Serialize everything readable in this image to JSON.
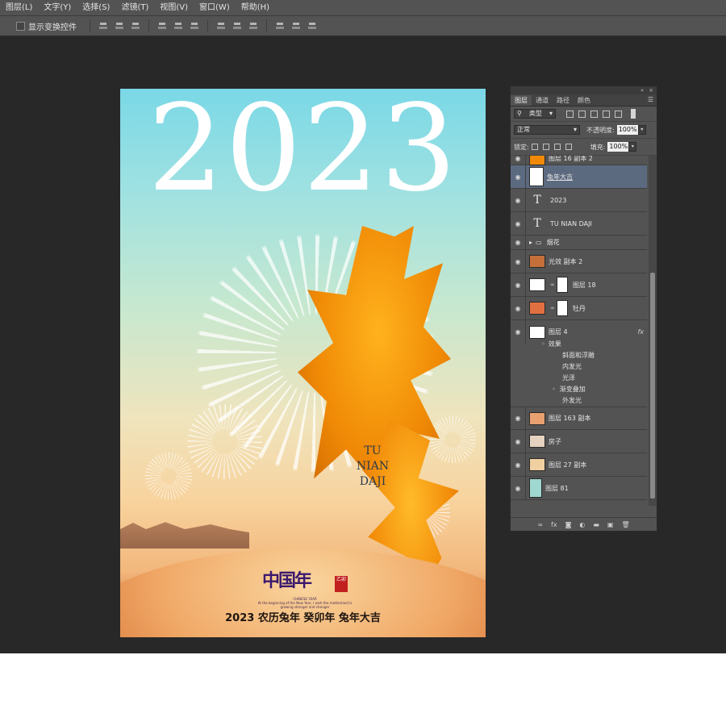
{
  "menu": [
    "图层(L)",
    "文字(Y)",
    "选择(S)",
    "滤镜(T)",
    "视图(V)",
    "窗口(W)",
    "帮助(H)"
  ],
  "options": {
    "show_transform_label": "显示变换控件"
  },
  "poster": {
    "year": "2023",
    "title_latin": [
      "TU",
      "NIAN",
      "DAJI"
    ],
    "brand": "中国年",
    "seal": "乙卯",
    "brand_sub": [
      "CHINESE YEAR",
      "At the beginning of the New Year, I wish the motherland is",
      "growing stronger and stronger"
    ],
    "footer": "2023 农历兔年 癸卯年 兔年大吉"
  },
  "panel": {
    "tabs": [
      "图层",
      "通道",
      "路径",
      "颜色"
    ],
    "filter_kind": "类型",
    "blend_mode": "正常",
    "opacity_label": "不透明度:",
    "opacity_value": "100%",
    "lock_label": "锁定:",
    "fill_label": "填充:",
    "fill_value": "100%"
  },
  "layers": [
    {
      "name": "图层 16 副本 2",
      "kind": "image",
      "thumb": "#f08a06"
    },
    {
      "name": "兔年大吉",
      "kind": "image",
      "thumb": "#ffffff",
      "selected": true
    },
    {
      "name": "2023",
      "kind": "text"
    },
    {
      "name": "TU NIAN DAJI",
      "kind": "text"
    },
    {
      "name": "烟花",
      "kind": "group"
    },
    {
      "name": "光效 副本 2",
      "kind": "image",
      "thumb": "#c5703a"
    },
    {
      "name": "图层 18",
      "kind": "masked",
      "thumb": "#ffffff"
    },
    {
      "name": "牡丹",
      "kind": "masked",
      "thumb": "#e07040"
    },
    {
      "name": "图层 4",
      "kind": "image",
      "thumb": "#ffffff",
      "fx": "fx"
    },
    {
      "name": "图层 163 副本",
      "kind": "image",
      "thumb": "#e8a070"
    },
    {
      "name": "房子",
      "kind": "image",
      "thumb": "#e6d2c0"
    },
    {
      "name": "图层 27 副本",
      "kind": "image",
      "thumb": "#f0d0a0"
    },
    {
      "name": "图层 81",
      "kind": "image",
      "thumb": "#9fd8d0"
    }
  ],
  "effects": {
    "header": "效果",
    "items": [
      "斜面和浮雕",
      "内发光",
      "光泽",
      "渐变叠加",
      "外发光"
    ]
  },
  "colors": {
    "app_bg": "#282828",
    "panel_bg": "#535353",
    "selected": "#5c6a80"
  }
}
